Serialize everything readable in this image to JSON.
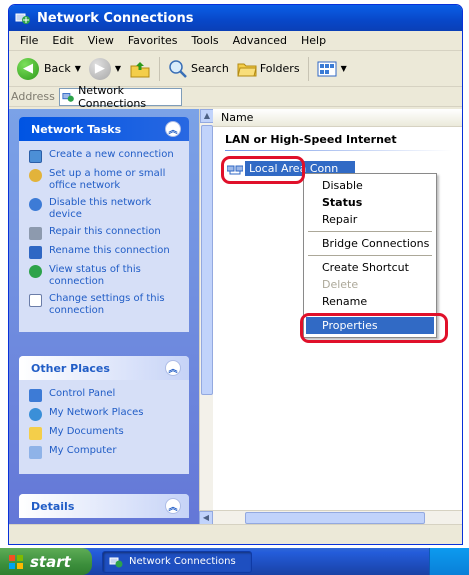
{
  "window": {
    "title": "Network Connections"
  },
  "menu": [
    "File",
    "Edit",
    "View",
    "Favorites",
    "Tools",
    "Advanced",
    "Help"
  ],
  "toolbar": {
    "back": "Back",
    "search": "Search",
    "folders": "Folders"
  },
  "address": {
    "label": "Address",
    "value": "Network Connections"
  },
  "network_tasks": {
    "title": "Network Tasks",
    "items": [
      {
        "label": "Create a new connection",
        "icon": "new-connection-icon"
      },
      {
        "label": "Set up a home or small office network",
        "icon": "home-network-icon"
      },
      {
        "label": "Disable this network device",
        "icon": "disable-device-icon"
      },
      {
        "label": "Repair this connection",
        "icon": "repair-icon"
      },
      {
        "label": "Rename this connection",
        "icon": "rename-icon"
      },
      {
        "label": "View status of this connection",
        "icon": "status-icon"
      },
      {
        "label": "Change settings of this connection",
        "icon": "settings-icon"
      }
    ]
  },
  "other_places": {
    "title": "Other Places",
    "items": [
      {
        "label": "Control Panel",
        "icon": "control-panel-icon"
      },
      {
        "label": "My Network Places",
        "icon": "network-places-icon"
      },
      {
        "label": "My Documents",
        "icon": "documents-icon"
      },
      {
        "label": "My Computer",
        "icon": "computer-icon"
      }
    ]
  },
  "details": {
    "title": "Details"
  },
  "list": {
    "column": "Name",
    "group": "LAN or High-Speed Internet",
    "item": "Local Area Conn"
  },
  "context_menu": {
    "disable": "Disable",
    "status": "Status",
    "repair": "Repair",
    "bridge": "Bridge Connections",
    "shortcut": "Create Shortcut",
    "delete": "Delete",
    "rename": "Rename",
    "properties": "Properties"
  },
  "taskbar": {
    "start": "start",
    "item": "Network Connections"
  },
  "colors": {
    "highlight": "#E0102A",
    "selection": "#316AC5",
    "xp_blue": "#0054E3"
  }
}
